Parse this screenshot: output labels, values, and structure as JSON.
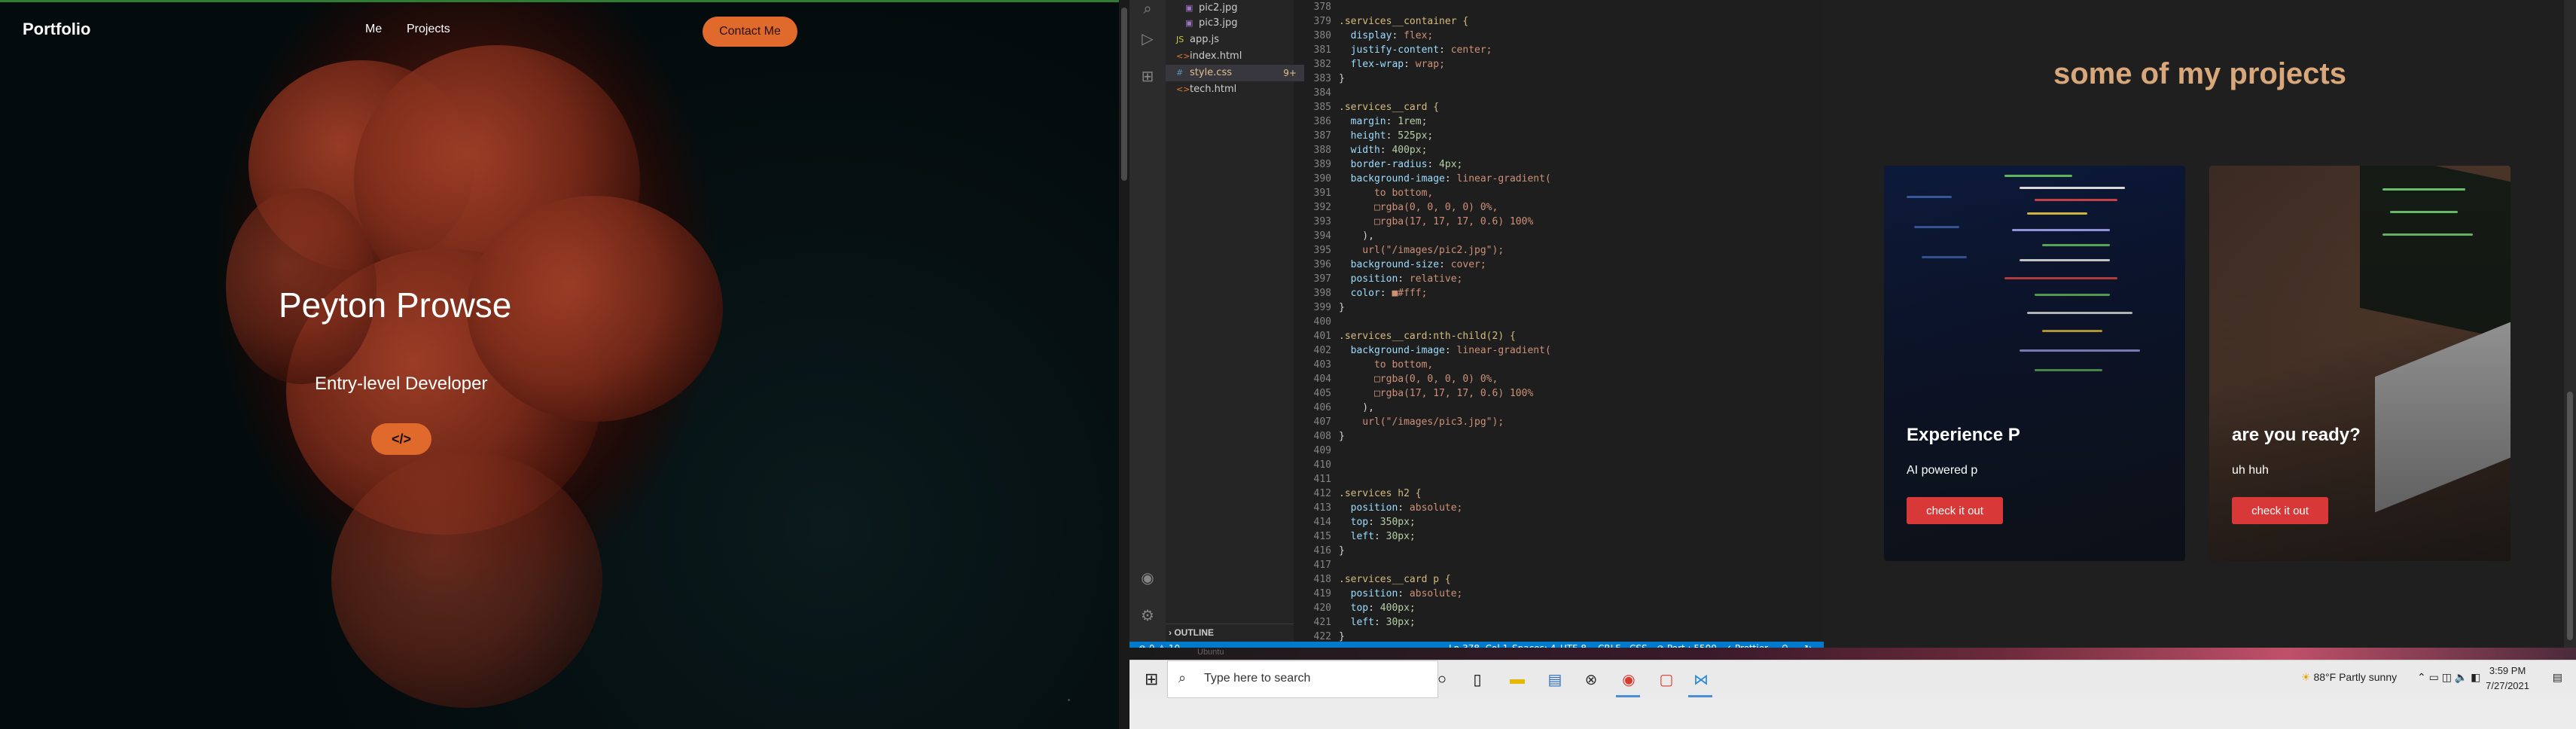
{
  "portfolio": {
    "logo": "Portfolio",
    "nav": [
      "Me",
      "Projects"
    ],
    "contact_button": "Contact Me",
    "name": "Peyton Prowse",
    "role": "Entry-level Developer",
    "code_button": "</>"
  },
  "vscode": {
    "explorer_files": [
      {
        "name": "pic2.jpg",
        "icon": "image-icon",
        "indent": 2
      },
      {
        "name": "pic3.jpg",
        "icon": "image-icon",
        "indent": 2
      },
      {
        "name": "app.js",
        "icon": "js-icon",
        "indent": 1
      },
      {
        "name": "index.html",
        "icon": "html-icon",
        "indent": 1
      },
      {
        "name": "style.css",
        "icon": "css-icon",
        "indent": 1,
        "active": true,
        "badge": "9+"
      },
      {
        "name": "tech.html",
        "icon": "html-icon",
        "indent": 1
      }
    ],
    "outline_label": "OUTLINE",
    "line_numbers": [
      "378",
      "379",
      "380",
      "381",
      "382",
      "383",
      "384",
      "385",
      "386",
      "387",
      "388",
      "389",
      "390",
      "391",
      "392",
      "393",
      "394",
      "395",
      "396",
      "397",
      "398",
      "399",
      "400",
      "401",
      "402",
      "403",
      "404",
      "405",
      "406",
      "407",
      "408",
      "409",
      "410",
      "411",
      "412",
      "413",
      "414",
      "415",
      "416",
      "417",
      "418",
      "419",
      "420",
      "421",
      "422"
    ],
    "code_lines": [
      "",
      ".services__container {",
      "  display: flex;",
      "  justify-content: center;",
      "  flex-wrap: wrap;",
      "}",
      "",
      ".services__card {",
      "  margin: 1rem;",
      "  height: 525px;",
      "  width: 400px;",
      "  border-radius: 4px;",
      "  background-image: linear-gradient(",
      "      to bottom,",
      "      □rgba(0, 0, 0, 0) 0%,",
      "      □rgba(17, 17, 17, 0.6) 100%",
      "    ),",
      "    url(\"/images/pic2.jpg\");",
      "  background-size: cover;",
      "  position: relative;",
      "  color: ■#fff;",
      "}",
      "",
      ".services__card:nth-child(2) {",
      "  background-image: linear-gradient(",
      "      to bottom,",
      "      □rgba(0, 0, 0, 0) 0%,",
      "      □rgba(17, 17, 17, 0.6) 100%",
      "    ),",
      "    url(\"/images/pic3.jpg\");",
      "}",
      "",
      "",
      "",
      ".services h2 {",
      "  position: absolute;",
      "  top: 350px;",
      "  left: 30px;",
      "}",
      "",
      ".services__card p {",
      "  position: absolute;",
      "  top: 400px;",
      "  left: 30px;",
      "}"
    ],
    "status": {
      "errors": "⊗ 0 ⚠ 10",
      "position": "Ln 378, Col 1",
      "spaces": "Spaces: 4",
      "encoding": "UTF-8",
      "eol": "CRLF",
      "language": "CSS",
      "port": "⊘ Port : 5500",
      "prettier": "✓ Prettier"
    }
  },
  "projects": {
    "title": "some of my projects",
    "cards": [
      {
        "title": "Experience P",
        "text": "AI powered p",
        "button": "check it out"
      },
      {
        "title": "are you ready?",
        "text": "uh huh",
        "button": "check it out"
      }
    ]
  },
  "taskbar": {
    "search_placeholder": "Type here to search",
    "weather": "88°F  Partly sunny",
    "time": "3:59 PM",
    "date": "7/27/2021",
    "strip_tag": "Ubuntu",
    "icons": [
      "cortana-icon",
      "task-view-icon",
      "file-explorer-icon",
      "store-icon",
      "xbox-icon",
      "chrome-icon",
      "office-icon",
      "vscode-icon"
    ]
  },
  "colors": {
    "accent_orange": "#e06a2c",
    "project_title": "#d9a87a",
    "card_button": "#d93838",
    "vscode_status": "#007acc"
  }
}
